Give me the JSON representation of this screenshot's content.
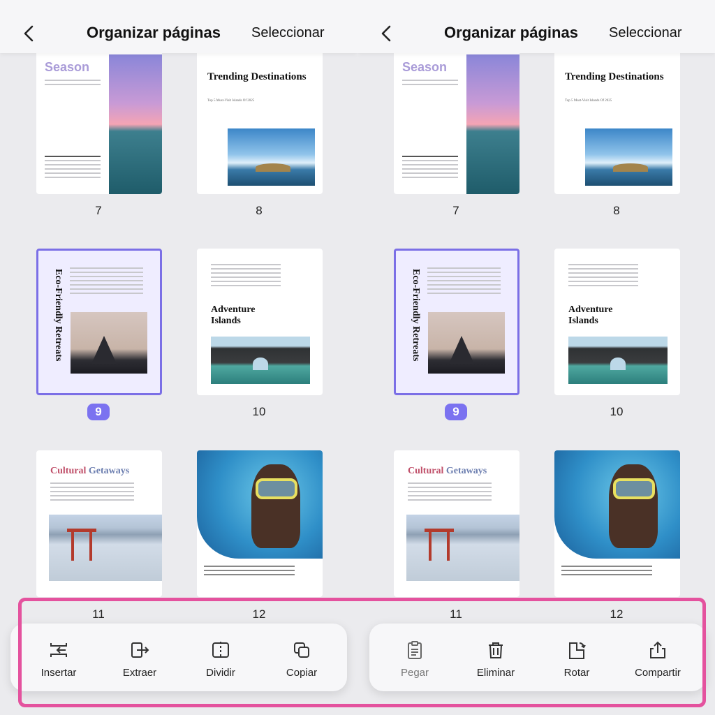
{
  "header": {
    "title": "Organizar páginas",
    "select_label": "Seleccionar"
  },
  "pages": [
    {
      "number": "7",
      "title": "Season"
    },
    {
      "number": "8",
      "title": "Trending Destinations",
      "subtitle": "Top 5 Must-Visit Islands Of 2025"
    },
    {
      "number": "9",
      "title": "Eco-Friendly Retreats",
      "selected": true
    },
    {
      "number": "10",
      "title": "Adventure Islands"
    },
    {
      "number": "11",
      "title_a": "Cultural",
      "title_b": "Getaways"
    },
    {
      "number": "12"
    }
  ],
  "toolbar_left": [
    {
      "label": "Insertar",
      "icon": "insert-icon"
    },
    {
      "label": "Extraer",
      "icon": "extract-icon"
    },
    {
      "label": "Dividir",
      "icon": "split-icon"
    },
    {
      "label": "Copiar",
      "icon": "copy-icon"
    }
  ],
  "toolbar_right": [
    {
      "label": "Pegar",
      "icon": "paste-icon",
      "disabled": true
    },
    {
      "label": "Eliminar",
      "icon": "trash-icon"
    },
    {
      "label": "Rotar",
      "icon": "rotate-icon"
    },
    {
      "label": "Compartir",
      "icon": "share-icon"
    }
  ],
  "colors": {
    "accent": "#7b6fe6",
    "highlight": "#e4529e",
    "season": "#a99bd8",
    "cultural_a": "#c0506a",
    "cultural_b": "#6d7fb0"
  }
}
